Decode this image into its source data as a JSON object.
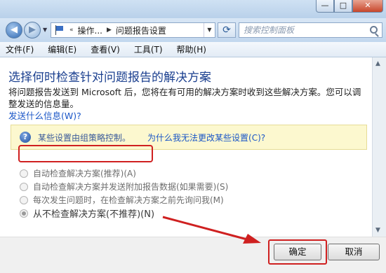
{
  "window": {
    "controls": {
      "minimize": "—",
      "maximize": "□",
      "close": "✕"
    }
  },
  "address_bar": {
    "back_icon": "◀",
    "forward_icon": "▶",
    "dropdown_icon": "▼",
    "prefix": "«",
    "crumbs": [
      "操作...",
      "问题报告设置"
    ],
    "separator": "▶",
    "refresh_icon": "⟳",
    "search_placeholder": "搜索控制面板"
  },
  "menu": [
    "文件(F)",
    "编辑(E)",
    "查看(V)",
    "工具(T)",
    "帮助(H)"
  ],
  "main": {
    "heading": "选择何时检查针对问题报告的解决方案",
    "description": "将问题报告发送到 Microsoft 后，您将在有可用的解决方案时收到这些解决方案。您可以调整发送的信息量。",
    "what_info_link": "发送什么信息(W)?",
    "info": {
      "icon": "?",
      "text": "某些设置由组策略控制。",
      "link": "为什么我无法更改某些设置(C)?"
    },
    "options": [
      {
        "label": "自动检查解决方案(推荐)(A)",
        "checked": false
      },
      {
        "label": "自动检查解决方案并发送附加报告数据(如果需要)(S)",
        "checked": false
      },
      {
        "label": "每次发生问题时，在检查解决方案之前先询问我(M)",
        "checked": false
      },
      {
        "label": "从不检查解决方案(不推荐)(N)",
        "checked": true
      }
    ]
  },
  "buttons": {
    "ok": "确定",
    "cancel": "取消"
  },
  "colors": {
    "annotation_red": "#cf2020",
    "heading_blue": "#1a3f8f",
    "link_blue": "#1a56c7"
  }
}
